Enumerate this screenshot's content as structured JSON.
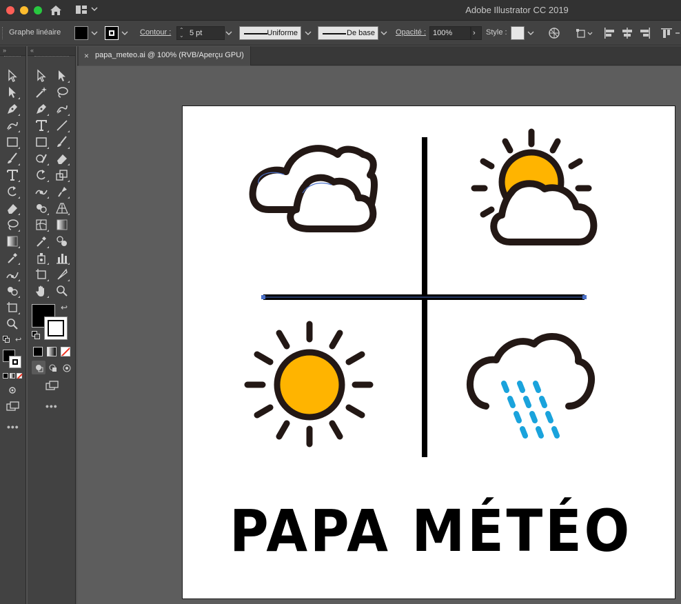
{
  "app": {
    "title": "Adobe Illustrator CC 2019"
  },
  "controlbar": {
    "selection_label": "Graphe linéaire",
    "contour_label": "Contour :",
    "contour_value": "5 pt",
    "stroke_profile": "Uniforme",
    "brush": "De base",
    "opacity_label": "Opacité :",
    "opacity_value": "100%",
    "style_label": "Style :"
  },
  "document_tab": {
    "close_glyph": "×",
    "name": "papa_meteo.ai @ 100% (RVB/Aperçu GPU)"
  },
  "artboard": {
    "headline": "PAPA MÉTÉO"
  },
  "colors": {
    "sun": "#ffb400",
    "outline": "#231815",
    "rain": "#1aa3dc",
    "selection": "#4a70c9"
  },
  "icons": {
    "weather": [
      "cloudy-icon",
      "partly-sunny-icon",
      "sunny-icon",
      "rain-icon"
    ]
  }
}
